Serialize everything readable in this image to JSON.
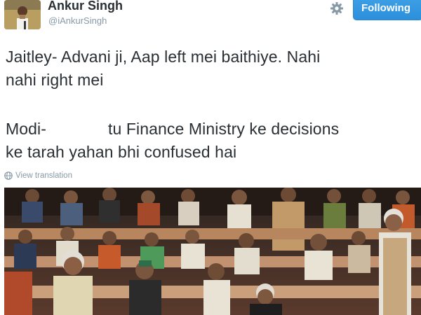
{
  "user": {
    "name": "Ankur Singh",
    "handle": "@iAnkurSingh"
  },
  "actions": {
    "follow_label": "Following",
    "settings_icon": "gear-icon"
  },
  "tweet": {
    "line1": "Jaitley- Advani ji, Aap left mei baithiye. Nahi",
    "line2": "nahi right mei",
    "line3_prefix": "Modi-",
    "line3_suffix": "tu Finance Ministry ke decisions",
    "line4": "ke tarah yahan bhi confused hai"
  },
  "translation": {
    "label": "View translation",
    "icon": "globe-icon"
  },
  "colors": {
    "follow_button": "#2b8fdb",
    "text": "#292f33",
    "muted": "#8899a6"
  }
}
